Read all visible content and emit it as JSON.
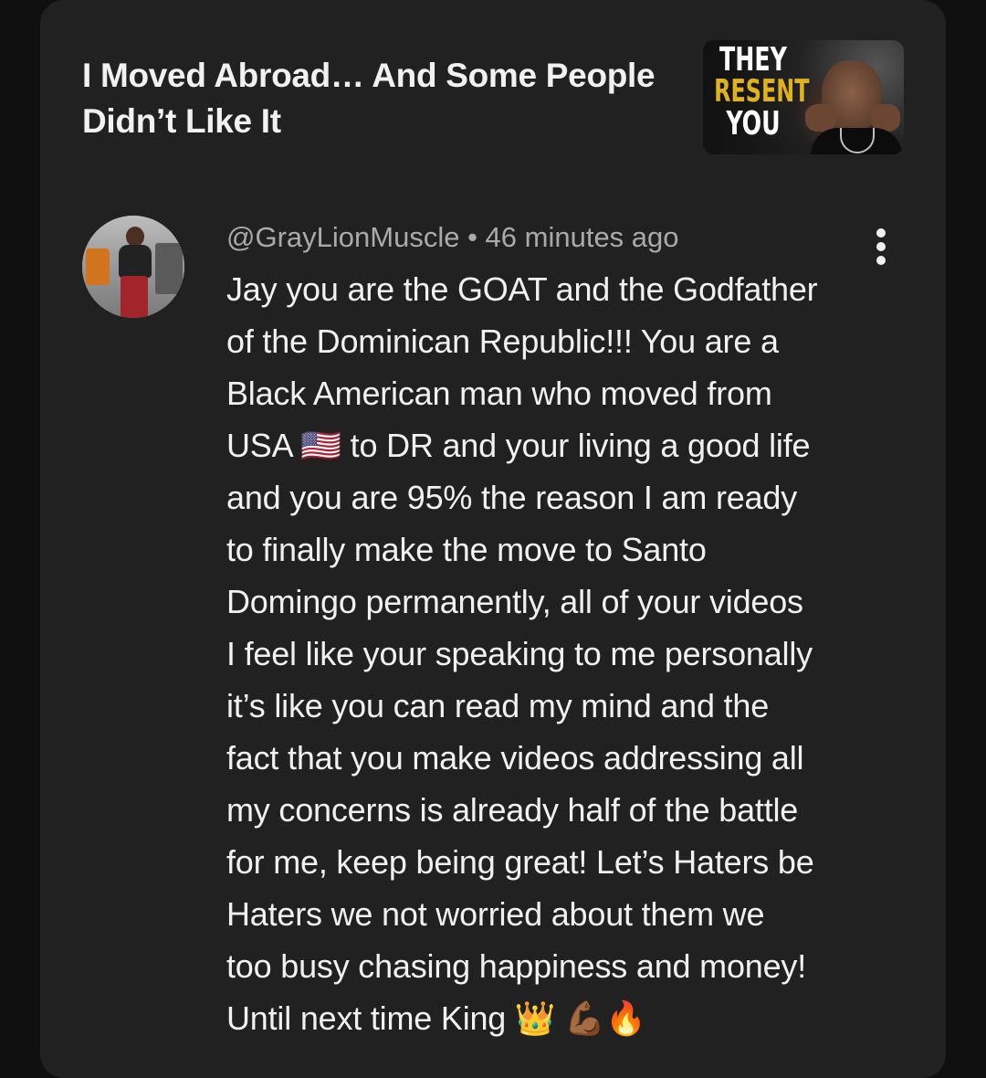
{
  "video": {
    "title": "I Moved Abroad… And Some People\nDidn’t Like It",
    "thumbnail": {
      "word1": "THEY",
      "word2": "RESENT",
      "word3": "YOU"
    }
  },
  "comment": {
    "handle": "@GrayLionMuscle",
    "separator": " • ",
    "time": "46 minutes ago",
    "text": "Jay you are the GOAT and the Godfather\nof the Dominican Republic!!! You are a\nBlack American man who moved from\nUSA 🇺🇸 to DR and your living a good life\nand you are 95% the reason I am ready\nto finally make the move to Santo\nDomingo permanently, all of your videos\nI feel like your speaking to me personally\nit’s like you can read my mind and the\nfact that you make videos addressing all\nmy concerns is already half of the battle\nfor me, keep being great! Let’s Haters be\nHaters we not worried about them we\ntoo busy chasing happiness and money!\nUntil next time King 👑 💪🏾🔥"
  },
  "icons": {
    "menu": "more-vertical-icon"
  }
}
